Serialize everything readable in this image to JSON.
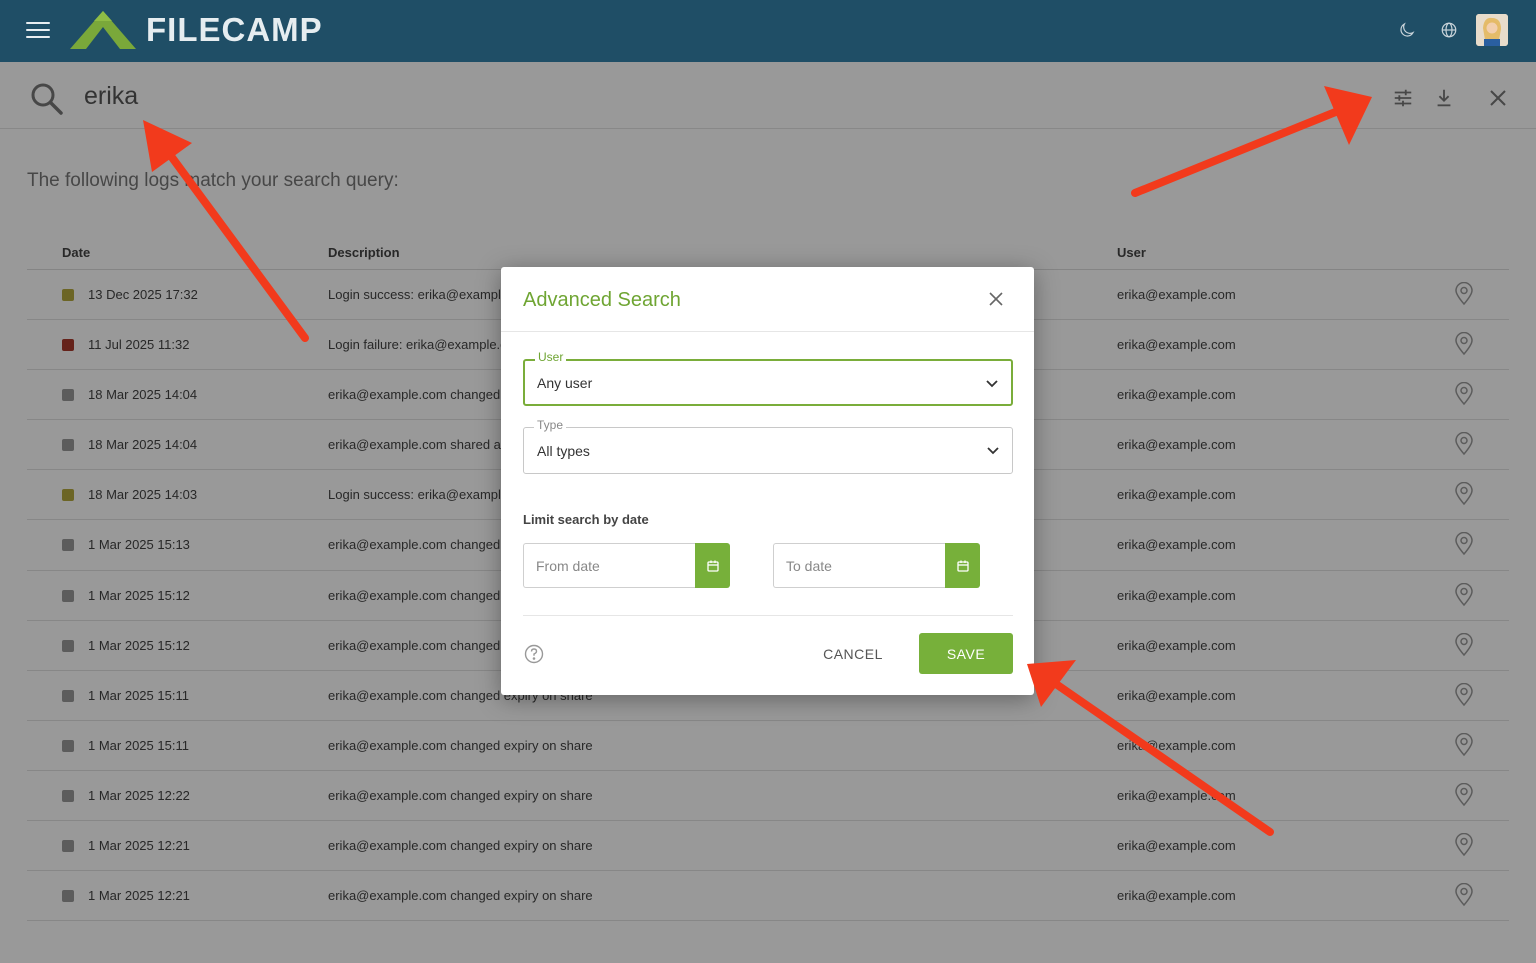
{
  "app": {
    "brand": "FILECAMP",
    "colors": {
      "header_bg": "#1f4e66",
      "accent": "#77b03a",
      "title_green": "#6fa533",
      "annotation": "#f23a1c"
    },
    "icons": [
      "hamburger-icon",
      "moon-icon",
      "globe-icon",
      "avatar"
    ]
  },
  "search": {
    "query": "erika",
    "actions": [
      "filter-settings-icon",
      "download-icon",
      "close-icon"
    ]
  },
  "intro_text": "The following logs match your search query:",
  "table": {
    "headers": {
      "date": "Date",
      "description": "Description",
      "user": "User"
    },
    "rows": [
      {
        "date": "13 Dec 2025 17:32",
        "description": "Login success: erika@example.com",
        "user": "erika@example.com",
        "color": "#b5a93e"
      },
      {
        "date": "11 Jul 2025 11:32",
        "description": "Login failure: erika@example.com",
        "user": "erika@example.com",
        "color": "#a83a2c"
      },
      {
        "date": "18 Mar 2025 14:04",
        "description": "erika@example.com changed",
        "user": "erika@example.com",
        "color": "#9a9a9a"
      },
      {
        "date": "18 Mar 2025 14:04",
        "description": "erika@example.com shared a",
        "user": "erika@example.com",
        "color": "#9a9a9a"
      },
      {
        "date": "18 Mar 2025 14:03",
        "description": "Login success: erika@example.com",
        "user": "erika@example.com",
        "color": "#b5a93e"
      },
      {
        "date": "1 Mar 2025 15:13",
        "description": "erika@example.com changed",
        "user": "erika@example.com",
        "color": "#9a9a9a"
      },
      {
        "date": "1 Mar 2025 15:12",
        "description": "erika@example.com changed",
        "user": "erika@example.com",
        "color": "#9a9a9a"
      },
      {
        "date": "1 Mar 2025 15:12",
        "description": "erika@example.com changed",
        "user": "erika@example.com",
        "color": "#9a9a9a"
      },
      {
        "date": "1 Mar 2025 15:11",
        "description": "erika@example.com changed expiry on share",
        "user": "erika@example.com",
        "color": "#9a9a9a"
      },
      {
        "date": "1 Mar 2025 15:11",
        "description": "erika@example.com changed expiry on share",
        "user": "erika@example.com",
        "color": "#9a9a9a"
      },
      {
        "date": "1 Mar 2025 12:22",
        "description": "erika@example.com changed expiry on share",
        "user": "erika@example.com",
        "color": "#9a9a9a"
      },
      {
        "date": "1 Mar 2025 12:21",
        "description": "erika@example.com changed expiry on share",
        "user": "erika@example.com",
        "color": "#9a9a9a"
      },
      {
        "date": "1 Mar 2025 12:21",
        "description": "erika@example.com changed expiry on share",
        "user": "erika@example.com",
        "color": "#9a9a9a"
      }
    ]
  },
  "modal": {
    "title": "Advanced Search",
    "user_field": {
      "label": "User",
      "value": "Any user"
    },
    "type_field": {
      "label": "Type",
      "value": "All types"
    },
    "limit_label": "Limit search by date",
    "from_placeholder": "From date",
    "to_placeholder": "To date",
    "cancel_label": "CANCEL",
    "save_label": "SAVE"
  }
}
